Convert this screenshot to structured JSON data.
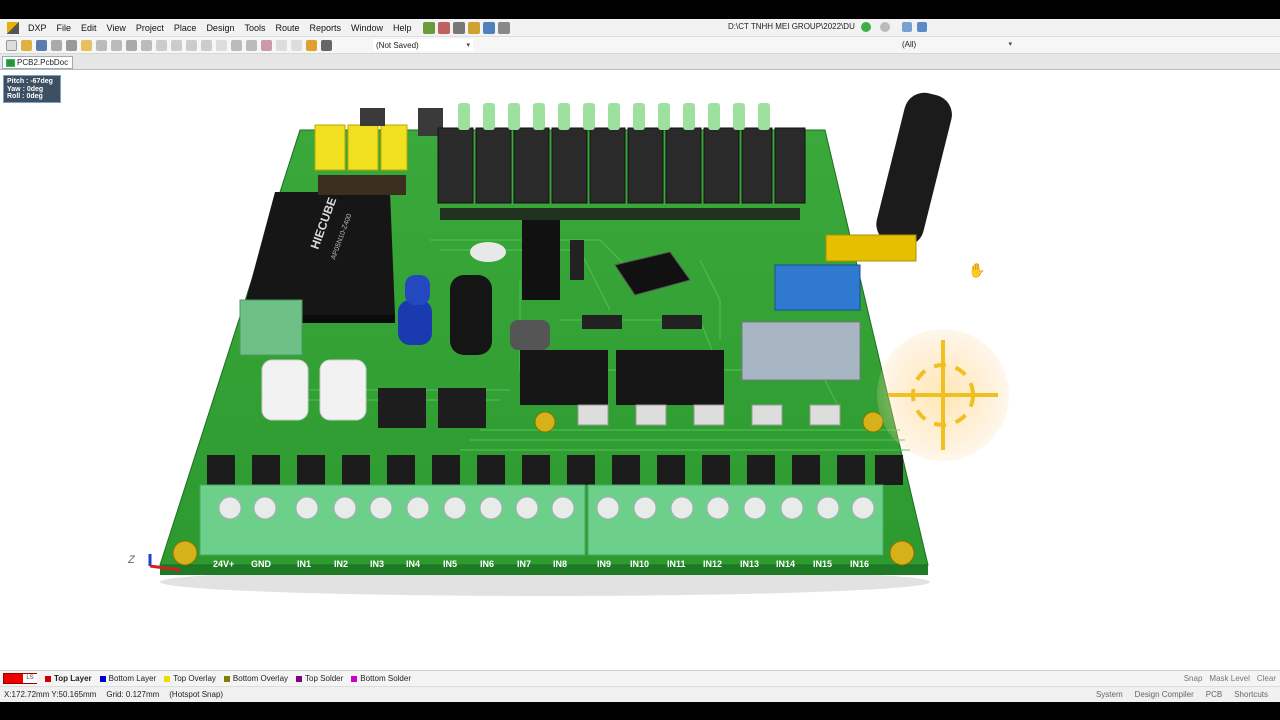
{
  "app": {
    "menus": [
      "DXP",
      "File",
      "Edit",
      "View",
      "Project",
      "Place",
      "Design",
      "Tools",
      "Route",
      "Reports",
      "Window",
      "Help"
    ],
    "path": "D:\\CT TNHH MEI GROUP\\2022\\DU",
    "selection_dropdown": "(Not Saved)",
    "filter_dropdown": "(All)"
  },
  "document": {
    "tab": "PCB2.PcbDoc"
  },
  "view_hud": {
    "pitch": "Pitch : -67deg",
    "yaw": "Yaw : 0deg",
    "roll": "Roll : 0deg"
  },
  "board": {
    "module_label_line1": "HIECUBE",
    "module_label_line2": "AP05N10-Z400",
    "terminal_labels": [
      "24V+",
      "GND",
      "IN1",
      "IN2",
      "IN3",
      "IN4",
      "IN5",
      "IN6",
      "IN7",
      "IN8",
      "IN9",
      "IN10",
      "IN11",
      "IN12",
      "IN13",
      "IN14",
      "IN15",
      "IN16"
    ],
    "axis_label": "Z"
  },
  "layers": {
    "ls_label": "LS",
    "tabs": [
      {
        "label": "Top Layer",
        "color": "#cc0000"
      },
      {
        "label": "Bottom Layer",
        "color": "#0000cc"
      },
      {
        "label": "Top Overlay",
        "color": "#e8e000"
      },
      {
        "label": "Bottom Overlay",
        "color": "#808000"
      },
      {
        "label": "Top Solder",
        "color": "#800080"
      },
      {
        "label": "Bottom Solder",
        "color": "#cc00cc"
      }
    ],
    "right_links": [
      "Snap",
      "Mask Level",
      "Clear"
    ]
  },
  "status": {
    "coordinates": "X:172.72mm Y:50.165mm",
    "grid": "Grid: 0.127mm",
    "snap": "(Hotspot Snap)",
    "panels": [
      "System",
      "Design Compiler",
      "PCB",
      "Shortcuts"
    ]
  }
}
